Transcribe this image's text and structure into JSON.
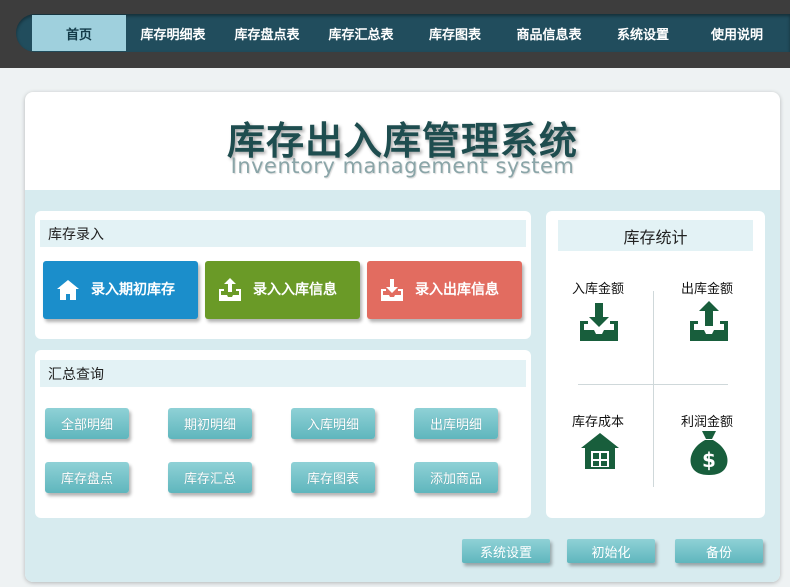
{
  "nav": {
    "items": [
      {
        "label": "首页",
        "active": true
      },
      {
        "label": "库存明细表"
      },
      {
        "label": "库存盘点表"
      },
      {
        "label": "库存汇总表"
      },
      {
        "label": "库存图表"
      },
      {
        "label": "商品信息表"
      },
      {
        "label": "系统设置"
      },
      {
        "label": "使用说明"
      }
    ]
  },
  "header": {
    "title": "库存出入库管理系统",
    "subtitle": "Inventory management system"
  },
  "entry": {
    "title": "库存录入",
    "buttons": [
      {
        "label": "录入期初库存",
        "color": "#1b8ecb",
        "icon": "home-icon"
      },
      {
        "label": "录入入库信息",
        "color": "#6a9a27",
        "icon": "tray-upload-icon"
      },
      {
        "label": "录入出库信息",
        "color": "#e26c60",
        "icon": "tray-download-icon"
      }
    ]
  },
  "query": {
    "title": "汇总查询",
    "buttons": [
      "全部明细",
      "期初明细",
      "入库明细",
      "出库明细",
      "库存盘点",
      "库存汇总",
      "库存图表",
      "添加商品"
    ]
  },
  "stats": {
    "title": "库存统计",
    "items": [
      {
        "label": "入库金额",
        "icon": "tray-download-icon"
      },
      {
        "label": "出库金额",
        "icon": "tray-upload-icon"
      },
      {
        "label": "库存成本",
        "icon": "warehouse-icon"
      },
      {
        "label": "利润金额",
        "icon": "money-bag-icon"
      }
    ],
    "icon_color": "#185e3c"
  },
  "footer": {
    "buttons": [
      "系统设置",
      "初始化",
      "备份"
    ]
  }
}
